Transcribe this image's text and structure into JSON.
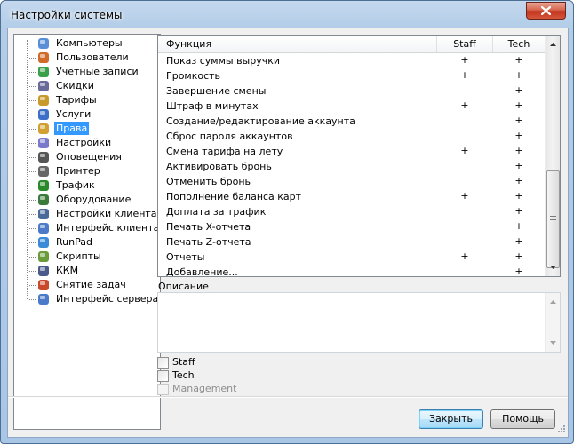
{
  "window": {
    "title": "Настройки системы"
  },
  "tree": {
    "items": [
      {
        "label": "Компьютеры",
        "icon": "computers-icon",
        "color": "#5a8fd8"
      },
      {
        "label": "Пользователи",
        "icon": "users-icon",
        "color": "#d06b2a"
      },
      {
        "label": "Учетные записи",
        "icon": "accounts-icon",
        "color": "#3aa04a"
      },
      {
        "label": "Скидки",
        "icon": "discounts-icon",
        "color": "#6a6a9a"
      },
      {
        "label": "Тарифы",
        "icon": "tariffs-icon",
        "color": "#c89a2a"
      },
      {
        "label": "Услуги",
        "icon": "services-icon",
        "color": "#3c6fc8"
      },
      {
        "label": "Права",
        "icon": "rights-icon",
        "color": "#d0a030",
        "selected": true
      },
      {
        "label": "Настройки",
        "icon": "settings-icon",
        "color": "#7a7acc"
      },
      {
        "label": "Оповещения",
        "icon": "notifications-icon",
        "color": "#555555"
      },
      {
        "label": "Принтер",
        "icon": "printer-icon",
        "color": "#666666"
      },
      {
        "label": "Трафик",
        "icon": "traffic-icon",
        "color": "#2a8a2a"
      },
      {
        "label": "Оборудование",
        "icon": "hardware-icon",
        "color": "#3a7a3a"
      },
      {
        "label": "Настройки клиента",
        "icon": "client-settings-icon",
        "color": "#4a6a9a"
      },
      {
        "label": "Интерфейс клиента",
        "icon": "client-interface-icon",
        "color": "#4a7ac8"
      },
      {
        "label": "RunPad",
        "icon": "runpad-icon",
        "color": "#3a8ad8"
      },
      {
        "label": "Скрипты",
        "icon": "scripts-icon",
        "color": "#6a9a3a"
      },
      {
        "label": "ККМ",
        "icon": "kkm-icon",
        "color": "#4a5a8a"
      },
      {
        "label": "Снятие задач",
        "icon": "tasks-icon",
        "color": "#c84a2a"
      },
      {
        "label": "Интерфейс сервера",
        "icon": "server-interface-icon",
        "color": "#4a7ac8"
      }
    ]
  },
  "grid": {
    "headers": {
      "function": "Функция",
      "staff": "Staff",
      "tech": "Tech"
    },
    "rows": [
      {
        "function": "Показ суммы выручки",
        "staff": "+",
        "tech": "+"
      },
      {
        "function": "Громкость",
        "staff": "+",
        "tech": "+"
      },
      {
        "function": "Завершение смены",
        "staff": "",
        "tech": "+"
      },
      {
        "function": "Штраф в минутах",
        "staff": "+",
        "tech": "+"
      },
      {
        "function": "Создание/редактирование аккаунта",
        "staff": "",
        "tech": "+"
      },
      {
        "function": "Сброс пароля аккаунтов",
        "staff": "",
        "tech": "+"
      },
      {
        "function": "Смена тарифа на лету",
        "staff": "+",
        "tech": "+"
      },
      {
        "function": "Активировать бронь",
        "staff": "",
        "tech": "+"
      },
      {
        "function": "Отменить бронь",
        "staff": "",
        "tech": "+"
      },
      {
        "function": "Пополнение баланса карт",
        "staff": "+",
        "tech": "+"
      },
      {
        "function": "Доплата за трафик",
        "staff": "",
        "tech": "+"
      },
      {
        "function": "Печать X-отчета",
        "staff": "",
        "tech": "+"
      },
      {
        "function": "Печать Z-отчета",
        "staff": "",
        "tech": "+"
      },
      {
        "function": "Отчеты",
        "staff": "+",
        "tech": "+"
      },
      {
        "function": "Добавление...",
        "staff": "",
        "tech": "+"
      }
    ]
  },
  "description": {
    "label": "Описание",
    "value": ""
  },
  "checkboxes": [
    {
      "label": "Staff",
      "checked": false,
      "disabled": false
    },
    {
      "label": "Tech",
      "checked": false,
      "disabled": false
    },
    {
      "label": "Management",
      "checked": false,
      "disabled": true
    }
  ],
  "buttons": {
    "close": "Закрыть",
    "help": "Помощь"
  },
  "colors": {
    "selection": "#3399ff",
    "frame": "#a9c6e6",
    "close": "#c2361e"
  }
}
